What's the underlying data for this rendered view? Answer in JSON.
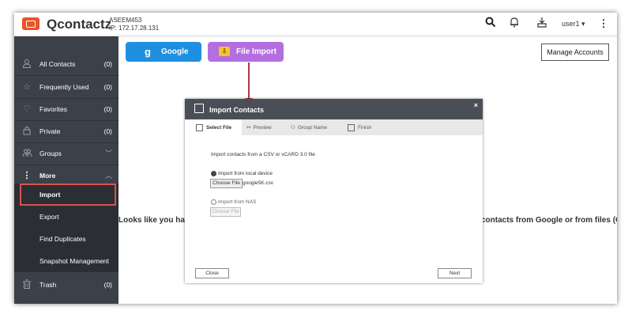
{
  "app": {
    "title": "Qcontactz",
    "server_name": "ASEEM453",
    "server_ip": "IP: 172.17.28.131"
  },
  "topbar": {
    "user": "user1",
    "icons": [
      "search-icon",
      "bell-icon",
      "download-icon",
      "kebab-menu-icon"
    ]
  },
  "sidebar": {
    "items": [
      {
        "label": "All Contacts",
        "count": "(0)",
        "icon": "person-icon"
      },
      {
        "label": "Frequently Used",
        "count": "(0)",
        "icon": "star-icon"
      },
      {
        "label": "Favorites",
        "count": "(0)",
        "icon": "heart-icon"
      },
      {
        "label": "Private",
        "count": "(0)",
        "icon": "lock-icon"
      },
      {
        "label": "Groups",
        "icon": "group-icon"
      },
      {
        "label": "More",
        "icon": "kebab-icon"
      }
    ],
    "sub_items": [
      {
        "label": "Import"
      },
      {
        "label": "Export"
      },
      {
        "label": "Find Duplicates"
      },
      {
        "label": "Snapshot Management"
      }
    ],
    "trash": {
      "label": "Trash",
      "count": "(0)",
      "icon": "trash-icon"
    }
  },
  "main": {
    "google_button": "Google",
    "file_import_button": "File Import",
    "manage_accounts_button": "Manage Accounts",
    "empty_left": "Looks like you have",
    "empty_right": "contacts from Google or from files (CSV"
  },
  "dialog": {
    "title": "Import Contacts",
    "close": "×",
    "steps": [
      "Select File",
      "Preview",
      "Group Name",
      "Finish"
    ],
    "intro": "Import contacts from a CSV or vCARD 3.0 file",
    "option_local": "Import from local device",
    "choose_file": "Choose File",
    "file_name": "google5K.csv",
    "option_nas": "Import from NAS",
    "choose_file_disabled": "Choose File",
    "close_button": "Close",
    "next_button": "Next"
  },
  "colors": {
    "accent_google": "#1f8fe0",
    "accent_file": "#b36fe0",
    "sidebar": "#3c4048",
    "highlight": "#d9534f"
  }
}
